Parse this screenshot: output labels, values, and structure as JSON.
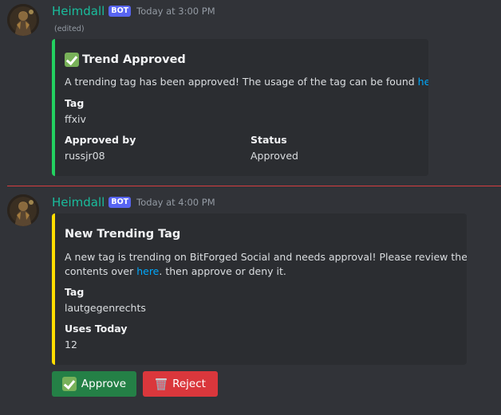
{
  "messages": [
    {
      "username": "Heimdall",
      "bot_tag": "BOT",
      "timestamp": "Today at 3:00 PM",
      "edited": "(edited)",
      "embed": {
        "accent_color": "#23d160",
        "title_icon": "check-mark-button-icon",
        "title": "Trend Approved",
        "description_text": "A trending tag has been approved! The usage of the tag can be found ",
        "description_link": "here",
        "description_end": ".",
        "fields": [
          {
            "name": "Tag",
            "value": "ffxiv"
          },
          {
            "name": "Approved by",
            "value": "russjr08"
          },
          {
            "name": "Status",
            "value": "Approved"
          }
        ]
      }
    },
    {
      "username": "Heimdall",
      "bot_tag": "BOT",
      "timestamp": "Today at 4:00 PM",
      "embed": {
        "accent_color": "#ffdd00",
        "title": "New Trending Tag",
        "description_line1": "A new tag is trending on BitForged Social and needs approval! Please review the",
        "description_line2_start": "contents over ",
        "description_link": "here",
        "description_line2_end": ". then approve or deny it.",
        "fields": [
          {
            "name": "Tag",
            "value": "lautgegenrechts"
          },
          {
            "name": "Uses Today",
            "value": "12"
          }
        ]
      },
      "buttons": [
        {
          "label": "Approve",
          "icon": "check-mark-button-icon",
          "style": "success",
          "color": "#248046"
        },
        {
          "label": "Reject",
          "icon": "wastebasket-icon",
          "style": "danger",
          "color": "#da373c"
        }
      ]
    }
  ],
  "colors": {
    "background": "#313338",
    "embed_background": "#2b2d31",
    "username": "#1abc9c",
    "bot_tag": "#5865f2",
    "link": "#00a8fc",
    "new_messages_divider": "#f23f43"
  }
}
